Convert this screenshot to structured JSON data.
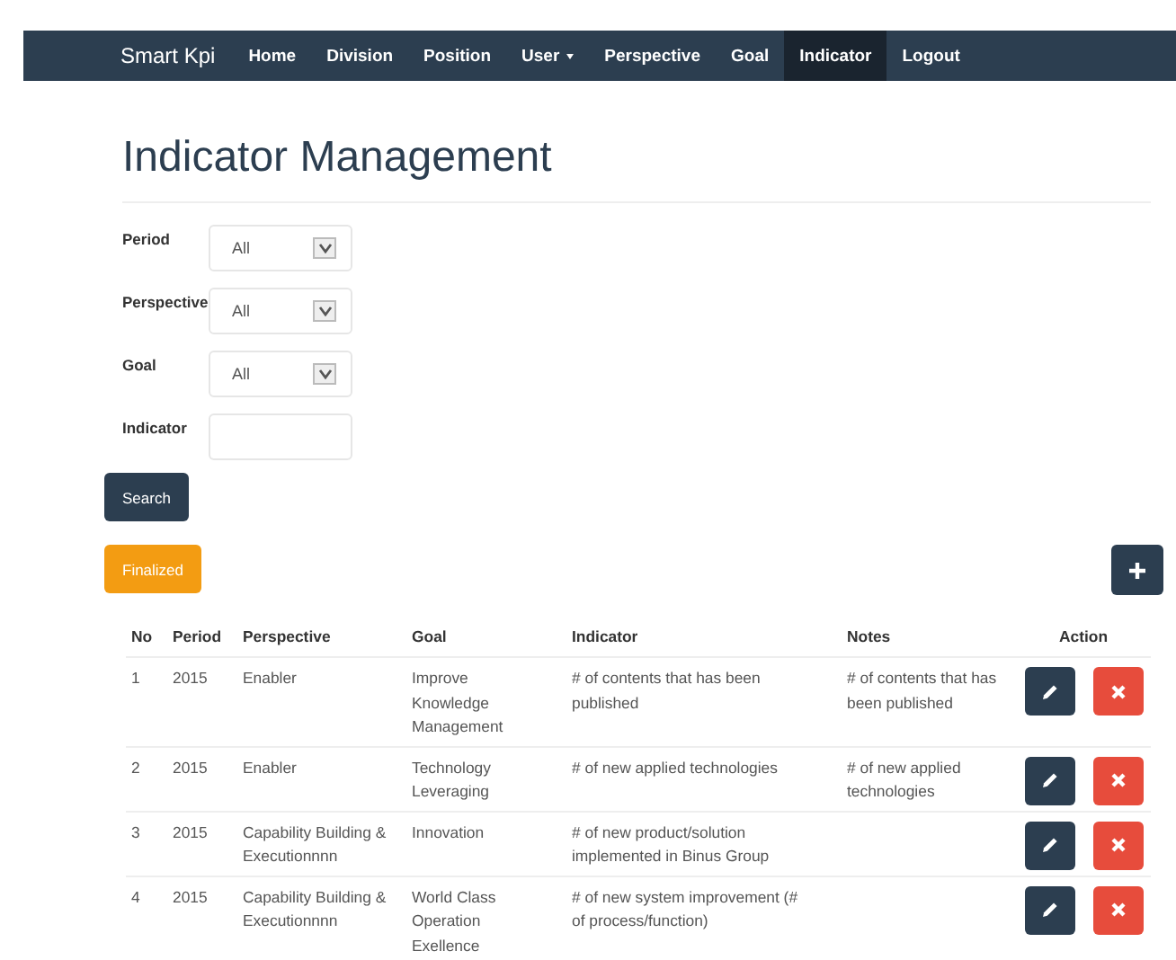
{
  "navbar": {
    "brand": "Smart Kpi",
    "items": [
      {
        "label": "Home",
        "selected": false,
        "dropdown": false
      },
      {
        "label": "Division",
        "selected": false,
        "dropdown": false
      },
      {
        "label": "Position",
        "selected": false,
        "dropdown": false
      },
      {
        "label": "User",
        "selected": false,
        "dropdown": true
      },
      {
        "label": "Perspective",
        "selected": false,
        "dropdown": false
      },
      {
        "label": "Goal",
        "selected": false,
        "dropdown": false
      },
      {
        "label": "Indicator",
        "selected": true,
        "dropdown": false
      },
      {
        "label": "Logout",
        "selected": false,
        "dropdown": false
      }
    ]
  },
  "title": "Indicator Management",
  "filters": [
    {
      "label": "Period",
      "kind": "select",
      "value": "All"
    },
    {
      "label": "Perspective",
      "kind": "select",
      "value": "All"
    },
    {
      "label": "Goal",
      "kind": "select",
      "value": "All"
    },
    {
      "label": "Indicator",
      "kind": "text"
    }
  ],
  "search_button": "Search",
  "finalized_button": "Finalized",
  "table": {
    "columns": [
      "No",
      "Period",
      "Perspective",
      "Goal",
      "Indicator",
      "Notes",
      "Action"
    ],
    "rows": [
      {
        "no": "1",
        "period": "2015",
        "perspective": "Enabler",
        "goal": "Improve Knowledge Management",
        "indicator": "# of contents that has been published",
        "notes": "# of contents that has been published"
      },
      {
        "no": "2",
        "period": "2015",
        "perspective": "Enabler",
        "goal": "Technology Leveraging",
        "indicator": "# of new applied technologies",
        "notes": "# of new applied technologies"
      },
      {
        "no": "3",
        "period": "2015",
        "perspective": "Capability Building & Executionnnn",
        "goal": "Innovation",
        "indicator": "# of new product/solution implemented in Binus Group"
      },
      {
        "no": "4",
        "period": "2015",
        "perspective": "Capability Building & Executionnnn",
        "goal": "World Class Operation Exellence",
        "indicator": "# of new system improvement (# of process/function)"
      }
    ]
  }
}
